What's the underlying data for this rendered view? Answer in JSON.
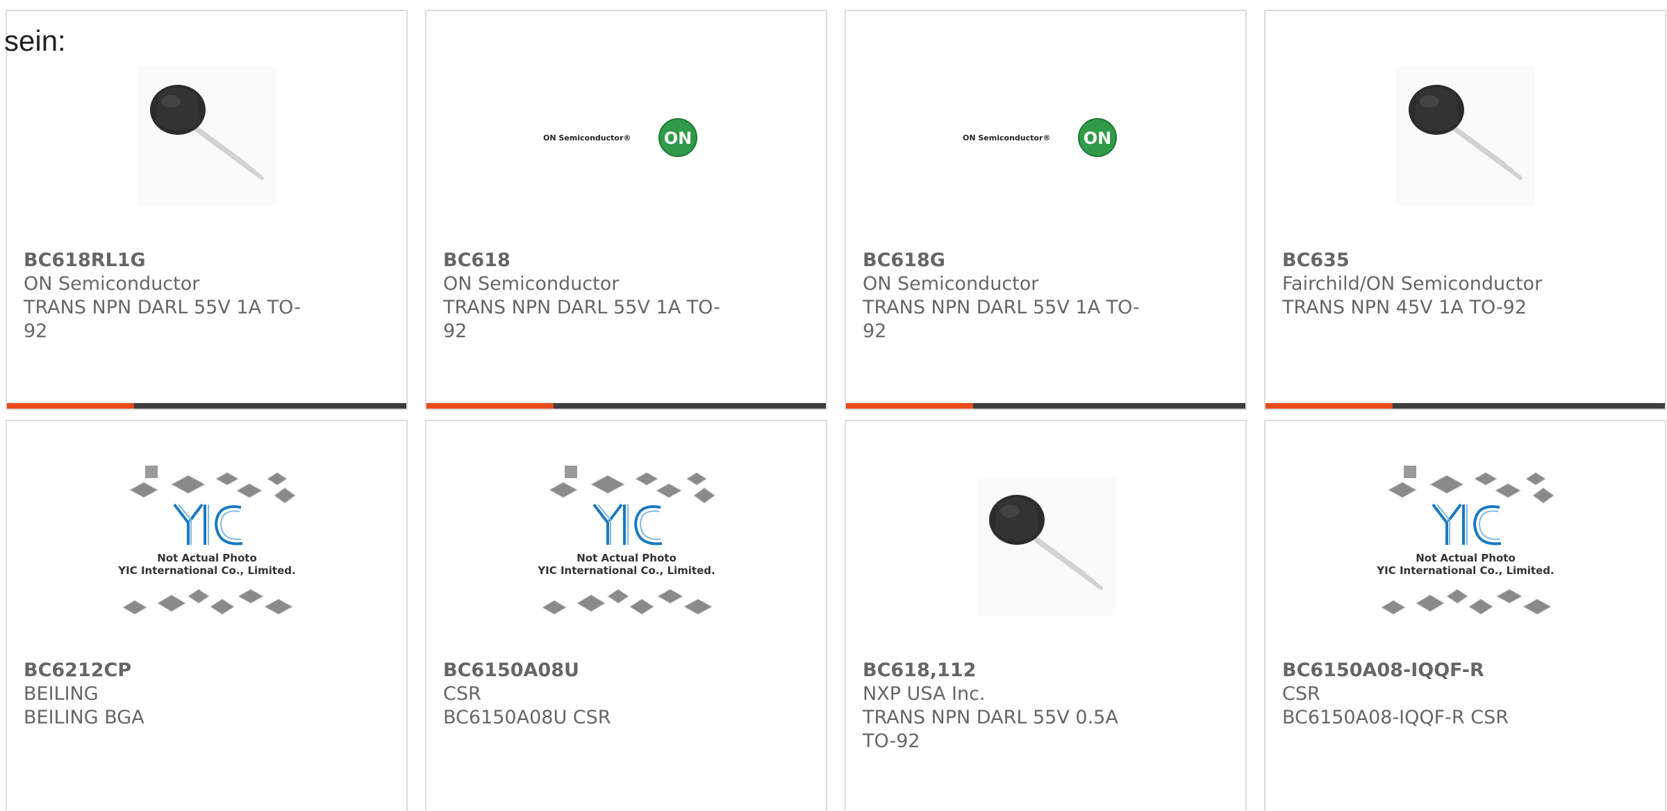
{
  "page": {
    "lead_text": "sein:"
  },
  "colors": {
    "accent": "#e84a1b",
    "bar_dark": "#3d3d3d",
    "on_logo_green": "#2f9a47",
    "yic_blue": "#1a78c2"
  },
  "products": [
    {
      "part_number": "BC618RL1G",
      "manufacturer": "ON Semiconductor",
      "description": "TRANS NPN DARL 55V 1A TO-92",
      "image_kind": "transistor-photo",
      "image_text": []
    },
    {
      "part_number": "BC618",
      "manufacturer": "ON Semiconductor",
      "description": "TRANS NPN DARL 55V 1A TO-92",
      "image_kind": "on-semiconductor-logo",
      "image_text": [
        "ON Semiconductor®",
        "ON"
      ]
    },
    {
      "part_number": "BC618G",
      "manufacturer": "ON Semiconductor",
      "description": "TRANS NPN DARL 55V 1A TO-92",
      "image_kind": "on-semiconductor-logo",
      "image_text": [
        "ON Semiconductor®",
        "ON"
      ]
    },
    {
      "part_number": "BC635",
      "manufacturer": "Fairchild/ON Semiconductor",
      "description": "TRANS NPN 45V 1A TO-92",
      "image_kind": "transistor-photo",
      "image_text": []
    },
    {
      "part_number": "BC6212CP",
      "manufacturer": "BEILING",
      "description": "BEILING BGA",
      "image_kind": "yic-placeholder",
      "image_text": [
        "Not Actual Photo",
        "YIC International Co., Limited."
      ]
    },
    {
      "part_number": "BC6150A08U",
      "manufacturer": "CSR",
      "description": "BC6150A08U CSR",
      "image_kind": "yic-placeholder",
      "image_text": [
        "Not Actual Photo",
        "YIC International Co., Limited."
      ]
    },
    {
      "part_number": "BC618,112",
      "manufacturer": "NXP USA Inc.",
      "description": "TRANS NPN DARL 55V 0.5A TO-92",
      "image_kind": "transistor-photo",
      "image_text": []
    },
    {
      "part_number": "BC6150A08-IQQF-R",
      "manufacturer": "CSR",
      "description": "BC6150A08-IQQF-R CSR",
      "image_kind": "yic-placeholder",
      "image_text": [
        "Not Actual Photo",
        "YIC International Co., Limited."
      ]
    }
  ]
}
